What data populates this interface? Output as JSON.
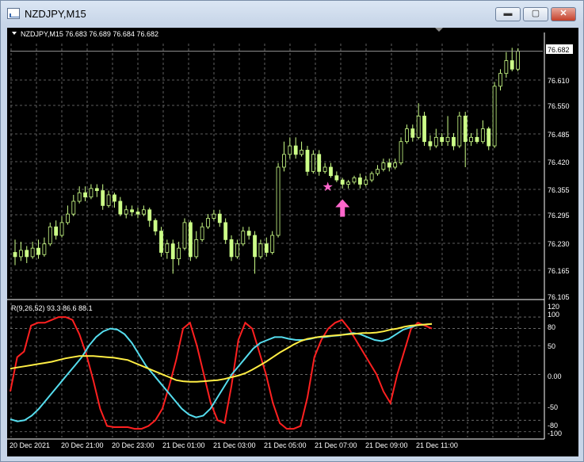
{
  "window": {
    "title": "NZDJPY,M15",
    "buttons": {
      "minimize": "▬",
      "restore": "▢",
      "close": "✕"
    }
  },
  "colors": {
    "background": "#000000",
    "grid": "#7a7a7a",
    "candle": "#ccff88",
    "red_line": "#ff2020",
    "cyan_line": "#55ddee",
    "yellow_line": "#ffee44",
    "marker": "#ff66cc"
  },
  "price_chart": {
    "header": "NZDJPY,M15  76.683 76.689 76.684 76.682",
    "current_price_label": "76.682",
    "price_labels": [
      "76.610",
      "76.550",
      "76.485",
      "76.420",
      "76.355",
      "76.295",
      "76.230",
      "76.165",
      "76.105"
    ],
    "markers": [
      {
        "name": "star-marker",
        "glyph": "★"
      },
      {
        "name": "up-arrow-marker",
        "glyph": "arrow-up"
      }
    ]
  },
  "indicator": {
    "label": "R(9,26,52) 93.3 86.6 88.1",
    "scale_labels": [
      "120",
      "100",
      "80",
      "50",
      "0.00",
      "-50",
      "-80",
      "-100"
    ]
  },
  "time_labels": [
    "20 Dec 2021",
    "20 Dec 21:00",
    "20 Dec 23:00",
    "21 Dec 01:00",
    "21 Dec 03:00",
    "21 Dec 05:00",
    "21 Dec 07:00",
    "21 Dec 09:00",
    "21 Dec 11:00"
  ],
  "chart_data": {
    "type": "candlestick",
    "symbol": "NZDJPY",
    "timeframe": "M15",
    "ylim": [
      76.105,
      76.7
    ],
    "indicator_ylim": [
      -110,
      125
    ],
    "candles": [
      [
        76.21,
        76.2,
        76.24,
        76.18
      ],
      [
        76.2,
        76.215,
        76.235,
        76.19
      ],
      [
        76.215,
        76.2,
        76.225,
        76.185
      ],
      [
        76.2,
        76.22,
        76.235,
        76.195
      ],
      [
        76.22,
        76.205,
        76.24,
        76.195
      ],
      [
        76.205,
        76.23,
        76.245,
        76.2
      ],
      [
        76.23,
        76.27,
        76.28,
        76.225
      ],
      [
        76.27,
        76.25,
        76.285,
        76.24
      ],
      [
        76.25,
        76.28,
        76.295,
        76.245
      ],
      [
        76.28,
        76.3,
        76.32,
        76.275
      ],
      [
        76.3,
        76.33,
        76.345,
        76.295
      ],
      [
        76.33,
        76.35,
        76.365,
        76.325
      ],
      [
        76.35,
        76.34,
        76.365,
        76.33
      ],
      [
        76.34,
        76.36,
        76.37,
        76.335
      ],
      [
        76.36,
        76.355,
        76.37,
        76.34
      ],
      [
        76.355,
        76.32,
        76.37,
        76.31
      ],
      [
        76.32,
        76.345,
        76.355,
        76.315
      ],
      [
        76.345,
        76.33,
        76.35,
        76.315
      ],
      [
        76.33,
        76.3,
        76.34,
        76.295
      ],
      [
        76.3,
        76.31,
        76.32,
        76.29
      ],
      [
        76.31,
        76.305,
        76.32,
        76.295
      ],
      [
        76.305,
        76.3,
        76.315,
        76.29
      ],
      [
        76.3,
        76.31,
        76.32,
        76.295
      ],
      [
        76.31,
        76.285,
        76.315,
        76.27
      ],
      [
        76.285,
        76.26,
        76.29,
        76.25
      ],
      [
        76.26,
        76.21,
        76.27,
        76.2
      ],
      [
        76.21,
        76.23,
        76.24,
        76.195
      ],
      [
        76.23,
        76.195,
        76.24,
        76.16
      ],
      [
        76.195,
        76.22,
        76.235,
        76.18
      ],
      [
        76.22,
        76.28,
        76.29,
        76.215
      ],
      [
        76.28,
        76.2,
        76.285,
        76.19
      ],
      [
        76.2,
        76.24,
        76.26,
        76.195
      ],
      [
        76.24,
        76.27,
        76.28,
        76.235
      ],
      [
        76.27,
        76.29,
        76.3,
        76.265
      ],
      [
        76.29,
        76.3,
        76.31,
        76.285
      ],
      [
        76.3,
        76.28,
        76.31,
        76.27
      ],
      [
        76.28,
        76.24,
        76.29,
        76.23
      ],
      [
        76.24,
        76.2,
        76.25,
        76.19
      ],
      [
        76.2,
        76.23,
        76.24,
        76.195
      ],
      [
        76.23,
        76.26,
        76.27,
        76.225
      ],
      [
        76.26,
        76.25,
        76.27,
        76.24
      ],
      [
        76.25,
        76.2,
        76.26,
        76.16
      ],
      [
        76.2,
        76.23,
        76.24,
        76.195
      ],
      [
        76.23,
        76.21,
        76.245,
        76.2
      ],
      [
        76.21,
        76.25,
        76.26,
        76.205
      ],
      [
        76.25,
        76.41,
        76.42,
        76.245
      ],
      [
        76.41,
        76.44,
        76.47,
        76.4
      ],
      [
        76.44,
        76.46,
        76.48,
        76.43
      ],
      [
        76.46,
        76.44,
        76.48,
        76.43
      ],
      [
        76.44,
        76.45,
        76.47,
        76.435
      ],
      [
        76.45,
        76.4,
        76.46,
        76.39
      ],
      [
        76.4,
        76.44,
        76.45,
        76.395
      ],
      [
        76.44,
        76.4,
        76.45,
        76.39
      ],
      [
        76.4,
        76.41,
        76.42,
        76.395
      ],
      [
        76.41,
        76.39,
        76.42,
        76.385
      ],
      [
        76.39,
        76.38,
        76.4,
        76.375
      ],
      [
        76.38,
        76.37,
        76.385,
        76.36
      ],
      [
        76.37,
        76.375,
        76.38,
        76.36
      ],
      [
        76.375,
        76.385,
        76.39,
        76.37
      ],
      [
        76.385,
        76.37,
        76.395,
        76.36
      ],
      [
        76.37,
        76.38,
        76.39,
        76.365
      ],
      [
        76.38,
        76.395,
        76.4,
        76.375
      ],
      [
        76.395,
        76.405,
        76.415,
        76.39
      ],
      [
        76.405,
        76.42,
        76.43,
        76.4
      ],
      [
        76.42,
        76.41,
        76.43,
        76.4
      ],
      [
        76.41,
        76.42,
        76.43,
        76.405
      ],
      [
        76.42,
        76.47,
        76.48,
        76.415
      ],
      [
        76.47,
        76.5,
        76.51,
        76.465
      ],
      [
        76.5,
        76.48,
        76.51,
        76.47
      ],
      [
        76.48,
        76.53,
        76.56,
        76.475
      ],
      [
        76.53,
        76.47,
        76.54,
        76.46
      ],
      [
        76.47,
        76.46,
        76.485,
        76.45
      ],
      [
        76.46,
        76.48,
        76.5,
        76.455
      ],
      [
        76.48,
        76.47,
        76.49,
        76.46
      ],
      [
        76.47,
        76.48,
        76.53,
        76.46
      ],
      [
        76.48,
        76.46,
        76.49,
        76.45
      ],
      [
        76.46,
        76.53,
        76.54,
        76.455
      ],
      [
        76.53,
        76.47,
        76.54,
        76.41
      ],
      [
        76.47,
        76.48,
        76.49,
        76.46
      ],
      [
        76.48,
        76.47,
        76.5,
        76.465
      ],
      [
        76.47,
        76.5,
        76.52,
        76.465
      ],
      [
        76.5,
        76.46,
        76.505,
        76.45
      ],
      [
        76.46,
        76.6,
        76.61,
        76.455
      ],
      [
        76.6,
        76.63,
        76.64,
        76.59
      ],
      [
        76.63,
        76.66,
        76.68,
        76.62
      ],
      [
        76.66,
        76.64,
        76.69,
        76.635
      ],
      [
        76.64,
        76.682,
        76.689,
        76.635
      ]
    ],
    "series": [
      {
        "color": "red",
        "values": [
          -30,
          30,
          40,
          85,
          90,
          90,
          95,
          100,
          100,
          95,
          70,
          35,
          -10,
          -60,
          -90,
          -92,
          -92,
          -92,
          -95,
          -95,
          -90,
          -80,
          -60,
          -20,
          25,
          80,
          90,
          50,
          0,
          -50,
          -80,
          -85,
          -20,
          60,
          90,
          80,
          40,
          0,
          -50,
          -85,
          -95,
          -95,
          -90,
          -40,
          30,
          60,
          80,
          90,
          95,
          80,
          60,
          40,
          20,
          0,
          -30,
          -50,
          0,
          40,
          80,
          90,
          85,
          80
        ]
      },
      {
        "color": "cyan",
        "values": [
          -78,
          -82,
          -80,
          -72,
          -60,
          -45,
          -30,
          -15,
          0,
          15,
          30,
          50,
          65,
          75,
          80,
          78,
          70,
          55,
          35,
          15,
          0,
          -15,
          -30,
          -45,
          -60,
          -70,
          -75,
          -72,
          -60,
          -40,
          -20,
          0,
          15,
          30,
          45,
          55,
          60,
          65,
          65,
          62,
          60,
          60,
          62,
          65,
          65,
          67,
          68,
          70,
          72,
          70,
          65,
          60,
          58,
          62,
          70,
          78,
          82,
          86,
          87,
          88
        ]
      },
      {
        "color": "yellow",
        "values": [
          10,
          12,
          14,
          16,
          18,
          20,
          22,
          25,
          28,
          30,
          32,
          32,
          32,
          31,
          30,
          29,
          27,
          25,
          20,
          15,
          10,
          5,
          0,
          -5,
          -10,
          -12,
          -13,
          -13,
          -12,
          -11,
          -10,
          -8,
          -5,
          -2,
          2,
          8,
          15,
          22,
          30,
          38,
          45,
          52,
          58,
          62,
          64,
          66,
          67,
          68,
          69,
          70,
          71,
          72,
          72,
          73,
          75,
          78,
          80,
          83,
          85,
          86,
          87,
          88
        ]
      }
    ]
  }
}
